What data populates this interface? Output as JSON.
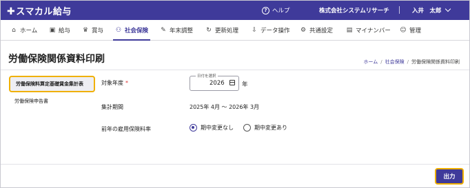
{
  "app": {
    "logo_plus": "✚",
    "logo_text": "スマカル給与"
  },
  "header": {
    "help_label": "ヘルプ",
    "company": "株式会社システムリサーチ",
    "user": "入井　太郎"
  },
  "nav": [
    {
      "label": "ホーム",
      "icon": "⌂"
    },
    {
      "label": "給与",
      "icon": "▣"
    },
    {
      "label": "賞与",
      "icon": "♛"
    },
    {
      "label": "社会保険",
      "icon": "⚇"
    },
    {
      "label": "年末調整",
      "icon": "✎"
    },
    {
      "label": "更新処理",
      "icon": "↻"
    },
    {
      "label": "データ操作",
      "icon": "⇩"
    },
    {
      "label": "共通設定",
      "icon": "⚙"
    },
    {
      "label": "マイナンバー",
      "icon": "▤"
    },
    {
      "label": "管理",
      "icon": "☺"
    }
  ],
  "page": {
    "title": "労働保険関係資料印刷"
  },
  "breadcrumb": {
    "home": "ホーム",
    "section": "社会保険",
    "current": "労働保険関係資料印刷"
  },
  "side_menu": [
    {
      "label": "労働保険料算定基礎賃金集計表"
    },
    {
      "label": "労働保険申告書"
    }
  ],
  "form": {
    "fiscal_year_label": "対象年度",
    "required_mark": "*",
    "date_legend": "日付を選択",
    "year_value": "2026",
    "year_unit": "年",
    "period_label": "集計期間",
    "period_value": "2025年 4月 ～ 2026年 3月",
    "rate_label": "前年の雇用保険料率",
    "rate_options": [
      {
        "label": "期中変更なし"
      },
      {
        "label": "期中変更あり"
      }
    ]
  },
  "footer": {
    "output_label": "出力"
  }
}
